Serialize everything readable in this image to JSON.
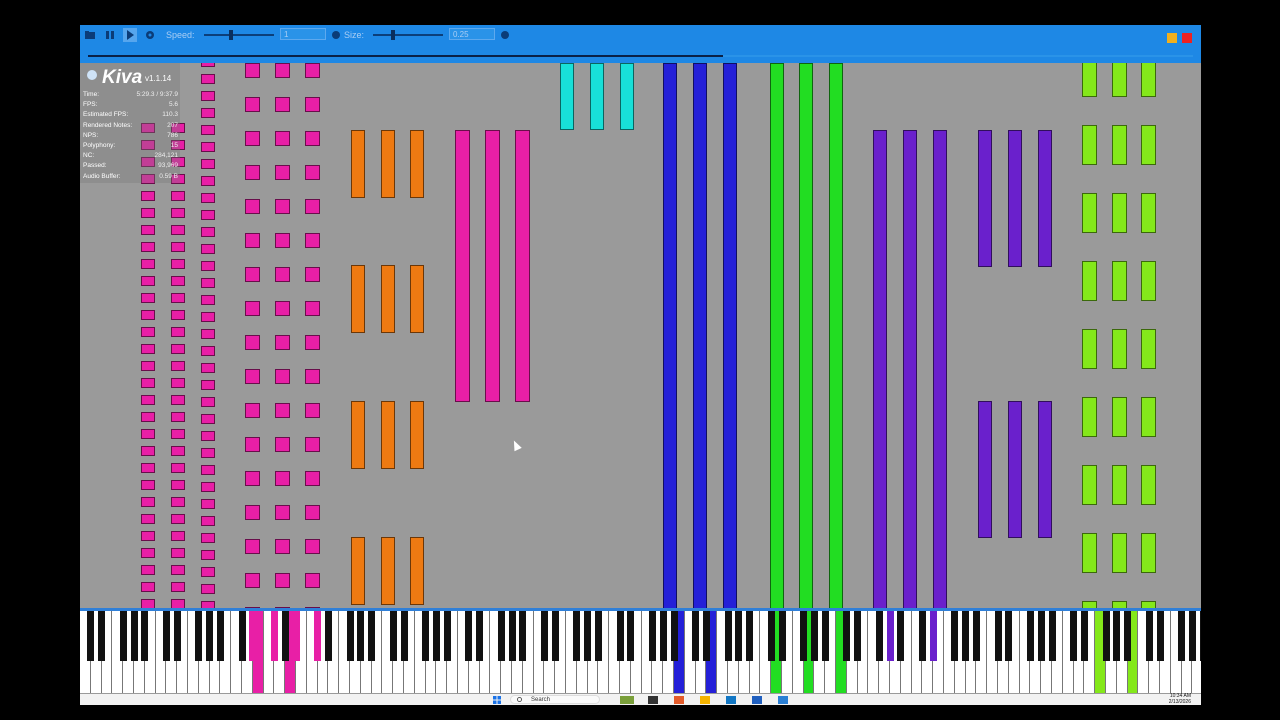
{
  "app": {
    "name": "Kiva",
    "version": "v1.1.14"
  },
  "toolbar": {
    "speed_label": "Speed:",
    "speed_value": "1",
    "size_label": "Size:",
    "size_value": "0.25",
    "seek_progress": 0.575,
    "speed_level": 0.35,
    "size_level": 0.25
  },
  "stats": [
    {
      "label": "Time:",
      "value": "5:29.3 / 9:37.9"
    },
    {
      "label": "FPS:",
      "value": "5.6"
    },
    {
      "label": "Estimated FPS:",
      "value": "110.3"
    },
    {
      "label": "Rendered Notes:",
      "value": "207"
    },
    {
      "label": "NPS:",
      "value": "786"
    },
    {
      "label": "Polyphony:",
      "value": "15"
    },
    {
      "label": "NC:",
      "value": "284,121"
    },
    {
      "label": "Passed:",
      "value": "93,969"
    },
    {
      "label": "Audio Buffer:",
      "value": "0.59 B"
    }
  ],
  "colors": {
    "magenta": "#e81fa6",
    "orange": "#ee7a12",
    "cyan": "#18e0d8",
    "blue": "#2420d8",
    "green": "#22dd22",
    "purple": "#6a20cc",
    "lime": "#84e81a",
    "toolbar": "#1e88e5"
  },
  "taskbar": {
    "search_placeholder": "Search",
    "time": "10:34 AM",
    "date": "2/13/2026"
  },
  "icons": [
    "open-file-icon",
    "pause-icon",
    "play-icon",
    "settings-icon",
    "help-icon",
    "minimize-icon",
    "close-icon",
    "windows-start-icon",
    "search-icon"
  ]
}
